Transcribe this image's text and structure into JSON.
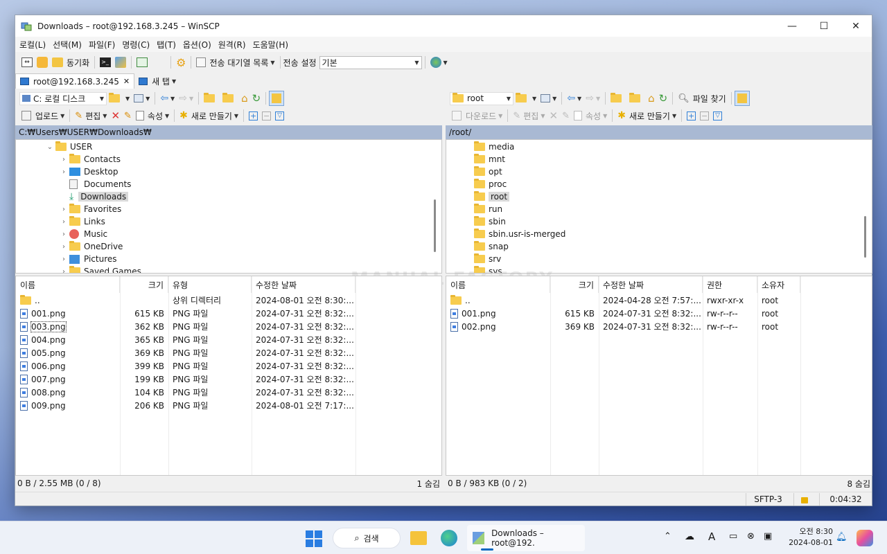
{
  "window": {
    "title": "Downloads – root@192.168.3.245 – WinSCP",
    "minimize": "—",
    "maximize": "☐",
    "close": "✕"
  },
  "menu": [
    "로컬(L)",
    "선택(M)",
    "파일(F)",
    "명령(C)",
    "탭(T)",
    "옵션(O)",
    "원격(R)",
    "도움말(H)"
  ],
  "toolbar": {
    "sync_label": "동기화",
    "queue_label": "전송 대기열 목록",
    "transfer_settings_label": "전송 설정",
    "transfer_settings_value": "기본"
  },
  "tabs": [
    {
      "label": "root@192.168.3.245",
      "close": "✕"
    },
    {
      "label": "새 탭"
    }
  ],
  "local": {
    "drive": "C: 로컬 디스크",
    "path": "C:₩Users₩USER₩Downloads₩",
    "actions": {
      "upload": "업로드",
      "edit": "편집",
      "properties": "속성",
      "new": "새로 만들기"
    },
    "tree": [
      {
        "label": "USER",
        "level": 0,
        "expanded": true
      },
      {
        "label": "Contacts",
        "level": 1
      },
      {
        "label": "Desktop",
        "level": 1
      },
      {
        "label": "Documents",
        "level": 1
      },
      {
        "label": "Downloads",
        "level": 1,
        "selected": true
      },
      {
        "label": "Favorites",
        "level": 1
      },
      {
        "label": "Links",
        "level": 1
      },
      {
        "label": "Music",
        "level": 1
      },
      {
        "label": "OneDrive",
        "level": 1
      },
      {
        "label": "Pictures",
        "level": 1
      },
      {
        "label": "Saved Games",
        "level": 1
      }
    ],
    "columns": [
      "이름",
      "크기",
      "유형",
      "수정한 날짜"
    ],
    "files": [
      {
        "name": "..",
        "size": "",
        "type": "상위 디렉터리",
        "date": "2024-08-01 오전 8:30:..."
      },
      {
        "name": "001.png",
        "size": "615 KB",
        "type": "PNG 파일",
        "date": "2024-07-31 오전 8:32:..."
      },
      {
        "name": "003.png",
        "size": "362 KB",
        "type": "PNG 파일",
        "date": "2024-07-31 오전 8:32:..."
      },
      {
        "name": "004.png",
        "size": "365 KB",
        "type": "PNG 파일",
        "date": "2024-07-31 오전 8:32:..."
      },
      {
        "name": "005.png",
        "size": "369 KB",
        "type": "PNG 파일",
        "date": "2024-07-31 오전 8:32:..."
      },
      {
        "name": "006.png",
        "size": "399 KB",
        "type": "PNG 파일",
        "date": "2024-07-31 오전 8:32:..."
      },
      {
        "name": "007.png",
        "size": "199 KB",
        "type": "PNG 파일",
        "date": "2024-07-31 오전 8:32:..."
      },
      {
        "name": "008.png",
        "size": "104 KB",
        "type": "PNG 파일",
        "date": "2024-07-31 오전 8:32:..."
      },
      {
        "name": "009.png",
        "size": "206 KB",
        "type": "PNG 파일",
        "date": "2024-08-01 오전 7:17:..."
      }
    ],
    "status_left": "0 B / 2.55 MB (0 / 8)",
    "status_right": "1 숨김"
  },
  "remote": {
    "dir": "root",
    "path": "/root/",
    "find_label": "파일 찾기",
    "actions": {
      "download": "다운로드",
      "edit": "편집",
      "properties": "속성",
      "new": "새로 만들기"
    },
    "tree": [
      "media",
      "mnt",
      "opt",
      "proc",
      "root",
      "run",
      "sbin",
      "sbin.usr-is-merged",
      "snap",
      "srv",
      "sys"
    ],
    "tree_selected": "root",
    "columns": [
      "이름",
      "크기",
      "수정한 날짜",
      "권한",
      "소유자"
    ],
    "files": [
      {
        "name": "..",
        "size": "",
        "date": "2024-04-28 오전 7:57:...",
        "perm": "rwxr-xr-x",
        "owner": "root"
      },
      {
        "name": "001.png",
        "size": "615 KB",
        "date": "2024-07-31 오전 8:32:...",
        "perm": "rw-r--r--",
        "owner": "root"
      },
      {
        "name": "002.png",
        "size": "369 KB",
        "date": "2024-07-31 오전 8:32:...",
        "perm": "rw-r--r--",
        "owner": "root"
      }
    ],
    "status_left": "0 B / 983 KB (0 / 2)",
    "status_right": "8 숨김"
  },
  "statusbar": {
    "protocol": "SFTP-3",
    "elapsed": "0:04:32"
  },
  "watermark": "MANUAL FACTORY",
  "taskbar": {
    "search": "검색",
    "app_label": "Downloads – root@192.",
    "time": "오전 8:30",
    "date": "2024-08-01"
  },
  "colors": {
    "path_bar": "#a9b9d3",
    "folder": "#f7cc4e",
    "accent": "#0067c0"
  }
}
